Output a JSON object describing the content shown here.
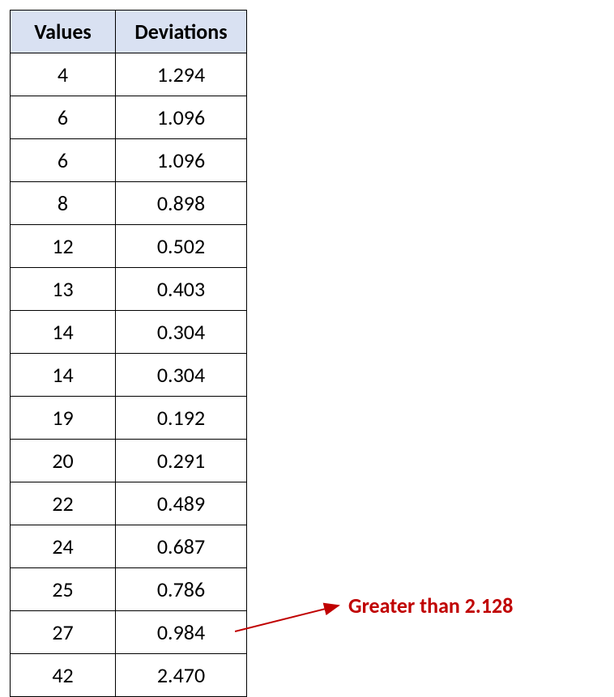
{
  "chart_data": {
    "type": "table",
    "title": "",
    "columns": [
      "Values",
      "Deviations"
    ],
    "rows": [
      {
        "value": "4",
        "deviation": "1.294"
      },
      {
        "value": "6",
        "deviation": "1.096"
      },
      {
        "value": "6",
        "deviation": "1.096"
      },
      {
        "value": "8",
        "deviation": "0.898"
      },
      {
        "value": "12",
        "deviation": "0.502"
      },
      {
        "value": "13",
        "deviation": "0.403"
      },
      {
        "value": "14",
        "deviation": "0.304"
      },
      {
        "value": "14",
        "deviation": "0.304"
      },
      {
        "value": "19",
        "deviation": "0.192"
      },
      {
        "value": "20",
        "deviation": "0.291"
      },
      {
        "value": "22",
        "deviation": "0.489"
      },
      {
        "value": "24",
        "deviation": "0.687"
      },
      {
        "value": "25",
        "deviation": "0.786"
      },
      {
        "value": "27",
        "deviation": "0.984"
      },
      {
        "value": "42",
        "deviation": "2.470"
      }
    ],
    "annotation": {
      "text": "Greater than 2.128",
      "points_to_row_index": 14
    }
  },
  "table": {
    "headers": {
      "col1": "Values",
      "col2": "Deviations"
    },
    "rows": [
      {
        "c1": "4",
        "c2": "1.294"
      },
      {
        "c1": "6",
        "c2": "1.096"
      },
      {
        "c1": "6",
        "c2": "1.096"
      },
      {
        "c1": "8",
        "c2": "0.898"
      },
      {
        "c1": "12",
        "c2": "0.502"
      },
      {
        "c1": "13",
        "c2": "0.403"
      },
      {
        "c1": "14",
        "c2": "0.304"
      },
      {
        "c1": "14",
        "c2": "0.304"
      },
      {
        "c1": "19",
        "c2": "0.192"
      },
      {
        "c1": "20",
        "c2": "0.291"
      },
      {
        "c1": "22",
        "c2": "0.489"
      },
      {
        "c1": "24",
        "c2": "0.687"
      },
      {
        "c1": "25",
        "c2": "0.786"
      },
      {
        "c1": "27",
        "c2": "0.984"
      },
      {
        "c1": "42",
        "c2": "2.470"
      }
    ]
  },
  "annotation_text": "Greater than 2.128"
}
